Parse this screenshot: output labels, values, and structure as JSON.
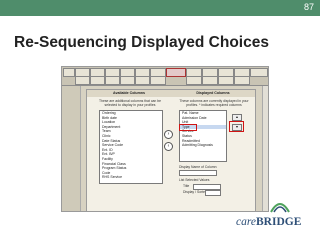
{
  "slide": {
    "number": "87",
    "title": "Re-Sequencing Displayed Choices"
  },
  "app": {
    "tabs_row1": [
      "",
      "",
      "",
      "",
      "",
      "",
      "",
      "",
      "",
      "",
      "",
      "",
      "",
      ""
    ],
    "tabs_row2": [
      "",
      "",
      "",
      "",
      "",
      "",
      "",
      "",
      "",
      "",
      "",
      "",
      "",
      ""
    ],
    "available_header": "Available Columns",
    "displayed_header": "Displayed Columns",
    "available_description": "These are additional columns that can be selected to display in your profiles",
    "displayed_description": "These columns are currently displayed in your profiles. * indicates required columns",
    "available_items": [
      "Ordering",
      "Birth date",
      "Location",
      "Department",
      "Team",
      "Clinic",
      "Date Status",
      "Service Code",
      "Ent. ID",
      "Ent. B/P",
      "Facility",
      "Financial Class",
      "Program Status",
      "Code",
      "RHS Service"
    ],
    "displayed_items": [
      "Pat. Name",
      "Admission Date",
      "Unit",
      "Type",
      "Service",
      "Status",
      "Readmitted",
      "Admitting Diagnosis"
    ],
    "selected_displayed_index": 3,
    "move_right_icon": "arrow-right-icon",
    "move_left_icon": "arrow-left-icon",
    "move_up_label": "▲",
    "move_down_label": "▼",
    "display_label": "Display Name of Column",
    "list_label": "List Selected Values",
    "title_label": "Title",
    "sort_label": "Display / Sorted"
  },
  "brand": {
    "logo_prefix": "care",
    "logo_suffix": "BRIDGE",
    "logo_icon": "carebridge-logo-icon"
  },
  "colors": {
    "topbar": "#4f8d6b",
    "logo_green": "#4fa35d",
    "logo_blue": "#2e4f77",
    "highlight": "#d01414"
  }
}
